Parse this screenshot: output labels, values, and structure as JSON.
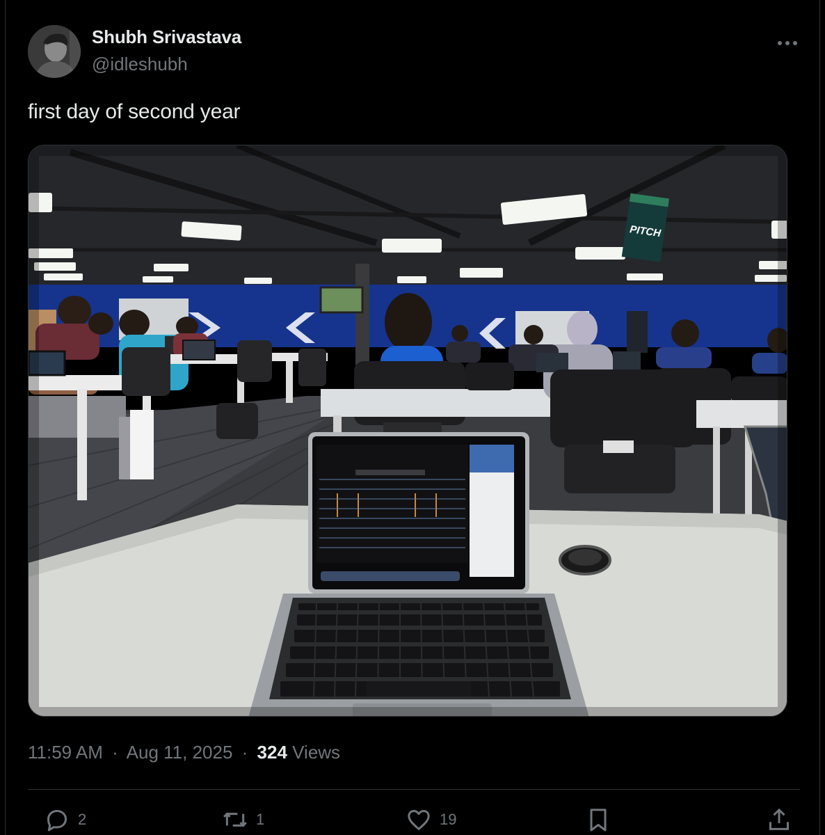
{
  "author": {
    "display_name": "Shubh Srivastava",
    "handle": "@idleshubh"
  },
  "tweet": {
    "text": "first day of second year"
  },
  "meta": {
    "time": "11:59 AM",
    "separator": "·",
    "date": "Aug 11, 2025",
    "views_count": "324",
    "views_label": "Views"
  },
  "actions": {
    "reply_count": "2",
    "retweet_count": "1",
    "like_count": "19"
  },
  "icons": {
    "more": "more-icon",
    "reply": "reply-icon",
    "retweet": "retweet-icon",
    "like": "heart-icon",
    "bookmark": "bookmark-icon",
    "share": "share-icon"
  },
  "photo_signage": {
    "banner_text": "PITCH"
  },
  "colors": {
    "background": "#000000",
    "primary_text": "#e7e9ea",
    "secondary_text": "#71767b",
    "border": "#2f3336"
  }
}
